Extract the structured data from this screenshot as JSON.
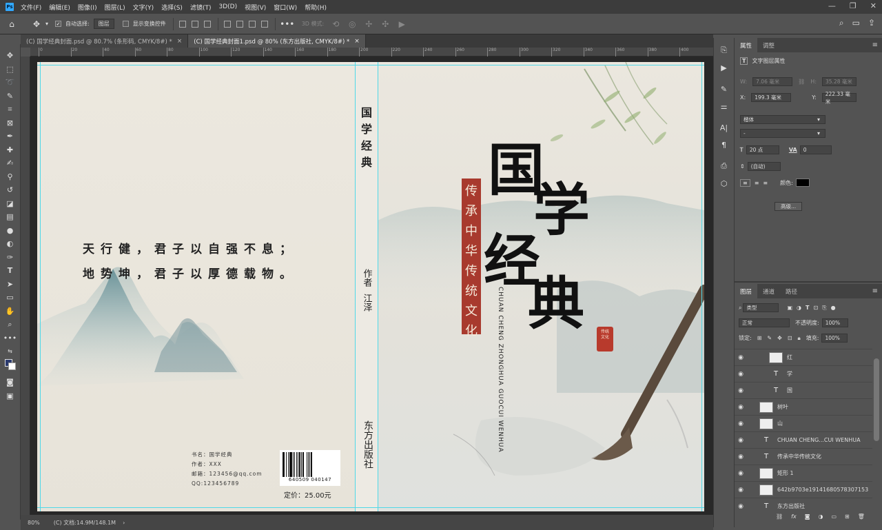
{
  "menu": {
    "items": [
      "文件(F)",
      "编辑(E)",
      "图像(I)",
      "图层(L)",
      "文字(Y)",
      "选择(S)",
      "滤镜(T)",
      "3D(D)",
      "视图(V)",
      "窗口(W)",
      "帮助(H)"
    ]
  },
  "options": {
    "auto_select_label": "自动选择:",
    "auto_select_value": "图层",
    "show_transform_label": "显示变换控件",
    "mode_3d_label": "3D 模式:"
  },
  "tabs": [
    {
      "label": "(C) 国学经典封面.psd @ 80.7% (条形码, CMYK/8#) *",
      "close": "×"
    },
    {
      "label": "(C) 国学经典封面1.psd @ 80% (东方出版社, CMYK/8#) *",
      "close": "×"
    }
  ],
  "ruler": {
    "ticks": [
      "0",
      "20",
      "40",
      "60",
      "80",
      "100",
      "120",
      "140",
      "160",
      "180",
      "200",
      "220",
      "240",
      "260",
      "280",
      "300",
      "320",
      "340",
      "360",
      "380",
      "400"
    ]
  },
  "cover": {
    "poem_line1": "天行健，君子以自强不息；",
    "poem_line2": "地势坤，君子以厚德载物。",
    "info_name": "书名：国学经典",
    "info_author": "作者：XXX",
    "info_email": "邮箱：123456@qq.com",
    "info_qq": "QQ:123456789",
    "barcode_number": "640509 040147",
    "price": "定价：25.00元",
    "spine_title": "国学经典",
    "spine_author_label": "作者",
    "spine_author_name": "江泽",
    "spine_publisher": "东方出版社",
    "title_char_1": "国",
    "title_char_2": "学",
    "title_char_3": "经",
    "title_char_4": "典",
    "banner_text": "传承中华传统文化",
    "pinyin_line1": "CHUAN CHENG ZHONGHUA",
    "pinyin_line2": "GUOCUI WENHUA",
    "seal_text": "传统文化"
  },
  "properties": {
    "tab_properties": "属性",
    "tab_adjust": "调整",
    "section_title": "文字图层属性",
    "w_label": "W:",
    "w_value": "7.06 毫米",
    "h_label": "H:",
    "h_value": "35.28 毫米",
    "x_label": "X:",
    "x_value": "199.3 毫米",
    "y_label": "Y:",
    "y_value": "222.33 毫米",
    "font_family": "楷体",
    "font_style": "-",
    "font_size": "20 点",
    "tracking_label": "VA",
    "tracking_value": "0",
    "leading_value": "(自动)",
    "color_label": "颜色:",
    "advanced_button": "高级..."
  },
  "layers": {
    "tab_layers": "图层",
    "tab_channels": "通道",
    "tab_paths": "路径",
    "filter_kind": "类型",
    "blend_mode": "正常",
    "opacity_label": "不透明度:",
    "opacity_value": "100%",
    "lock_label": "锁定:",
    "fill_label": "填充:",
    "fill_value": "100%",
    "items": [
      {
        "name": "红",
        "kind": "thumb"
      },
      {
        "name": "学",
        "kind": "text"
      },
      {
        "name": "国",
        "kind": "text"
      },
      {
        "name": "树叶",
        "kind": "thumb"
      },
      {
        "name": "山",
        "kind": "thumb"
      },
      {
        "name": "CHUAN CHENG...CUI WENHUA",
        "kind": "text"
      },
      {
        "name": "传承中华传统文化",
        "kind": "text"
      },
      {
        "name": "矩形 1",
        "kind": "thumb"
      },
      {
        "name": "642b9703e19141680578307153",
        "kind": "thumb"
      },
      {
        "name": "东方出版社",
        "kind": "text"
      }
    ]
  },
  "status": {
    "zoom": "80%",
    "doc_info": "(C) 文档:14.9M/148.1M"
  },
  "colors": {
    "accent": "#31a8ff",
    "banner_red": "#a83a2e",
    "guide_cyan": "#4fd8e8"
  }
}
